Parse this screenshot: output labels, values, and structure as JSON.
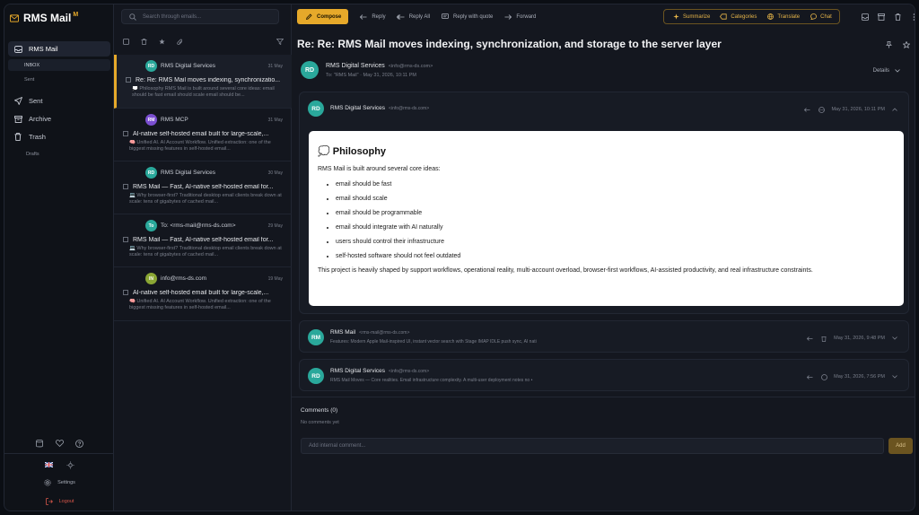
{
  "app": {
    "name": "RMS Mail",
    "badge": "M"
  },
  "sidebar": {
    "items": [
      {
        "label": "RMS Mail",
        "icon": "inbox-icon"
      },
      {
        "label": "INBOX"
      },
      {
        "label": "Sent"
      },
      {
        "label": "Sent",
        "icon": "send-icon"
      },
      {
        "label": "Archive",
        "icon": "archive-icon"
      },
      {
        "label": "Trash",
        "icon": "trash-icon"
      },
      {
        "label": "Drafts"
      }
    ],
    "settings": "Settings",
    "logout": "Logout"
  },
  "list": {
    "search_placeholder": "Search through emails...",
    "emails": [
      {
        "initials": "RD",
        "sender": "RMS Digital Services",
        "date": "31 May",
        "subject": "Re: Re: RMS Mail moves indexing, synchronizatio...",
        "preview": "💭 Philosophy RMS Mail is built around several core ideas: email should be fast email should scale email should be...",
        "color": "#2aa89b"
      },
      {
        "initials": "RM",
        "sender": "RMS MCP",
        "date": "31 May",
        "subject": "AI-native self-hosted email built for large-scale,...",
        "preview": "🧠 Unified AI. AI Account Workflow. Unified extraction: one of the biggest missing features in self-hosted email...",
        "color": "#7b4fd1"
      },
      {
        "initials": "RD",
        "sender": "RMS Digital Services",
        "date": "30 May",
        "subject": "RMS Mail — Fast, AI-native self-hosted email for...",
        "preview": "💻 Why browser-first? Traditional desktop email clients break down at scale: tens of gigabytes of cached mail...",
        "color": "#2aa89b"
      },
      {
        "initials": "To",
        "sender": "To: <rms-mail@rms-ds.com>",
        "date": "29 May",
        "subject": "RMS Mail — Fast, AI-native self-hosted email for...",
        "preview": "💻 Why browser-first? Traditional desktop email clients break down at scale: tens of gigabytes of cached mail...",
        "color": "#2aa89b"
      },
      {
        "initials": "IN",
        "sender": "info@rms-ds.com",
        "date": "19 May",
        "subject": "AI-native self-hosted email built for large-scale,...",
        "preview": "🧠 Unified AI. AI Account Workflow. Unified extraction: one of the biggest missing features in self-hosted email...",
        "color": "#8aa634"
      }
    ]
  },
  "toolbar": {
    "compose": "Compose",
    "reply": "Reply",
    "reply_all": "Reply All",
    "reply_quote": "Reply with quote",
    "forward": "Forward",
    "summarize": "Summarize",
    "categories": "Categories",
    "translate": "Translate",
    "chat": "Chat"
  },
  "message": {
    "title": "Re: Re: RMS Mail moves indexing, synchronization, and storage to the server layer",
    "header": {
      "initials": "RD",
      "sender": "RMS Digital Services",
      "email": "<info@rms-ds.com>",
      "to": "To: \"RMS Mail\" · May 31, 2026, 10:11 PM",
      "details": "Details"
    },
    "thread": [
      {
        "initials": "RD",
        "sender": "RMS Digital Services",
        "email": "<info@rms-ds.com>",
        "date": "May 31, 2026, 10:11 PM"
      },
      {
        "initials": "RM",
        "sender": "RMS Mail",
        "email": "<rms-mail@rms-ds.com>",
        "snippet": "Features: Modern Apple Mail-inspired UI, instant vector search with Stage IMAP IDLE push sync, AI nati",
        "date": "May 31, 2026, 9:48 PM"
      },
      {
        "initials": "RD",
        "sender": "RMS Digital Services",
        "email": "<info@rms-ds.com>",
        "snippet": "RMS Mail Moves — Core realities. Email infrastructure complexity. A multi-user deployment notes no •",
        "date": "May 31, 2026, 7:56 PM"
      }
    ],
    "body": {
      "heading": "💭 Philosophy",
      "intro": "RMS Mail is built around several core ideas:",
      "bullets": [
        "email should be fast",
        "email should scale",
        "email should be programmable",
        "email should integrate with AI naturally",
        "users should control their infrastructure",
        "self-hosted software should not feel outdated"
      ],
      "outro": "This project is heavily shaped by support workflows, operational reality, multi-account overload, browser-first workflows, AI-assisted productivity, and real infrastructure constraints."
    },
    "comments": {
      "title": "Comments (0)",
      "empty": "No comments yet",
      "placeholder": "Add internal comment...",
      "add": "Add"
    }
  }
}
